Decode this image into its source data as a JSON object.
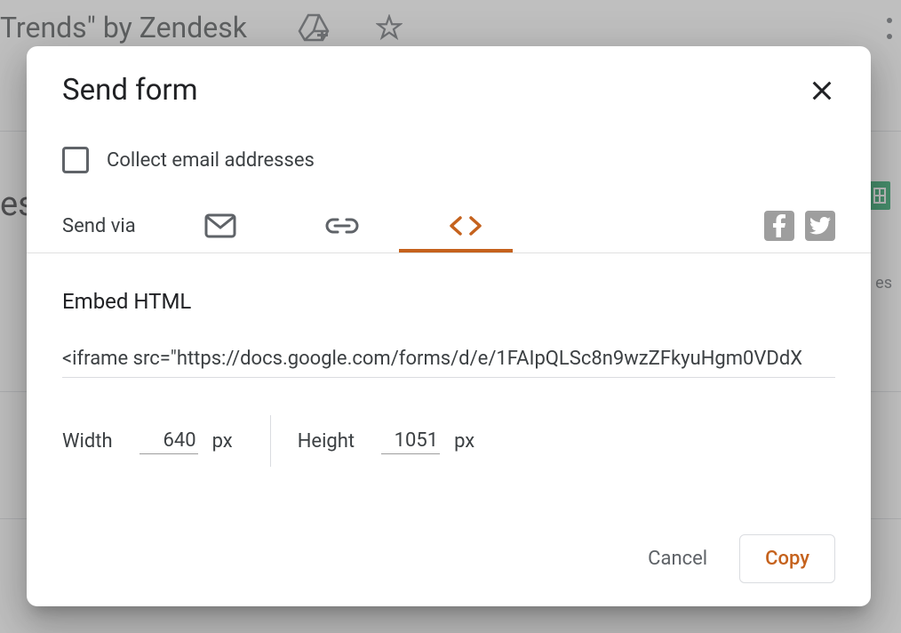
{
  "background": {
    "title_fragment": "Trends\" by Zendesk",
    "responses_fragment": "es",
    "right_text_fragment": "es"
  },
  "dialog": {
    "title": "Send form",
    "collect_label": "Collect email addresses",
    "send_via_label": "Send via",
    "embed": {
      "title": "Embed HTML",
      "code": "<iframe src=\"https://docs.google.com/forms/d/e/1FAIpQLSc8n9wzZFkyuHgm0VDdX"
    },
    "dims": {
      "width_label": "Width",
      "width_value": "640",
      "height_label": "Height",
      "height_value": "1051",
      "unit": "px"
    },
    "actions": {
      "cancel": "Cancel",
      "copy": "Copy"
    }
  }
}
